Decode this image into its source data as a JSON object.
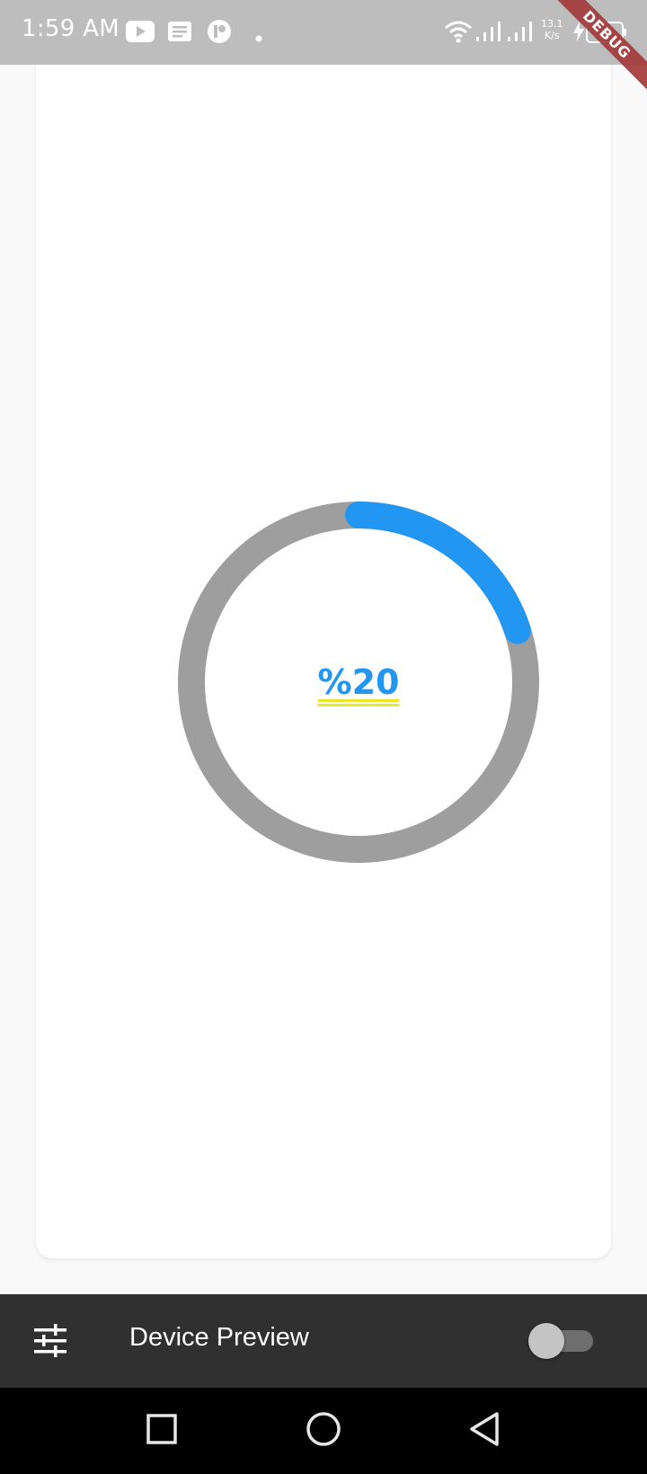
{
  "status_bar": {
    "time": "1:59 AM",
    "net_speed_value": "13.1",
    "net_speed_unit": "K/s",
    "battery": "98",
    "icons": [
      "youtube-icon",
      "notes-icon",
      "app-icon",
      "dot-icon",
      "wifi-icon",
      "signal-icon",
      "signal-icon",
      "charging-icon",
      "battery-icon"
    ]
  },
  "debug_banner": "DEBUG",
  "progress": {
    "label": "%20",
    "value": 0.2,
    "track_color": "#9e9e9e",
    "progress_color": "#2196f3"
  },
  "toolbar": {
    "title": "Device Preview",
    "settings_icon": "tune-icon",
    "toggle_on": false
  },
  "nav_bar": {
    "buttons": [
      "recents-icon",
      "home-icon",
      "back-icon"
    ]
  }
}
